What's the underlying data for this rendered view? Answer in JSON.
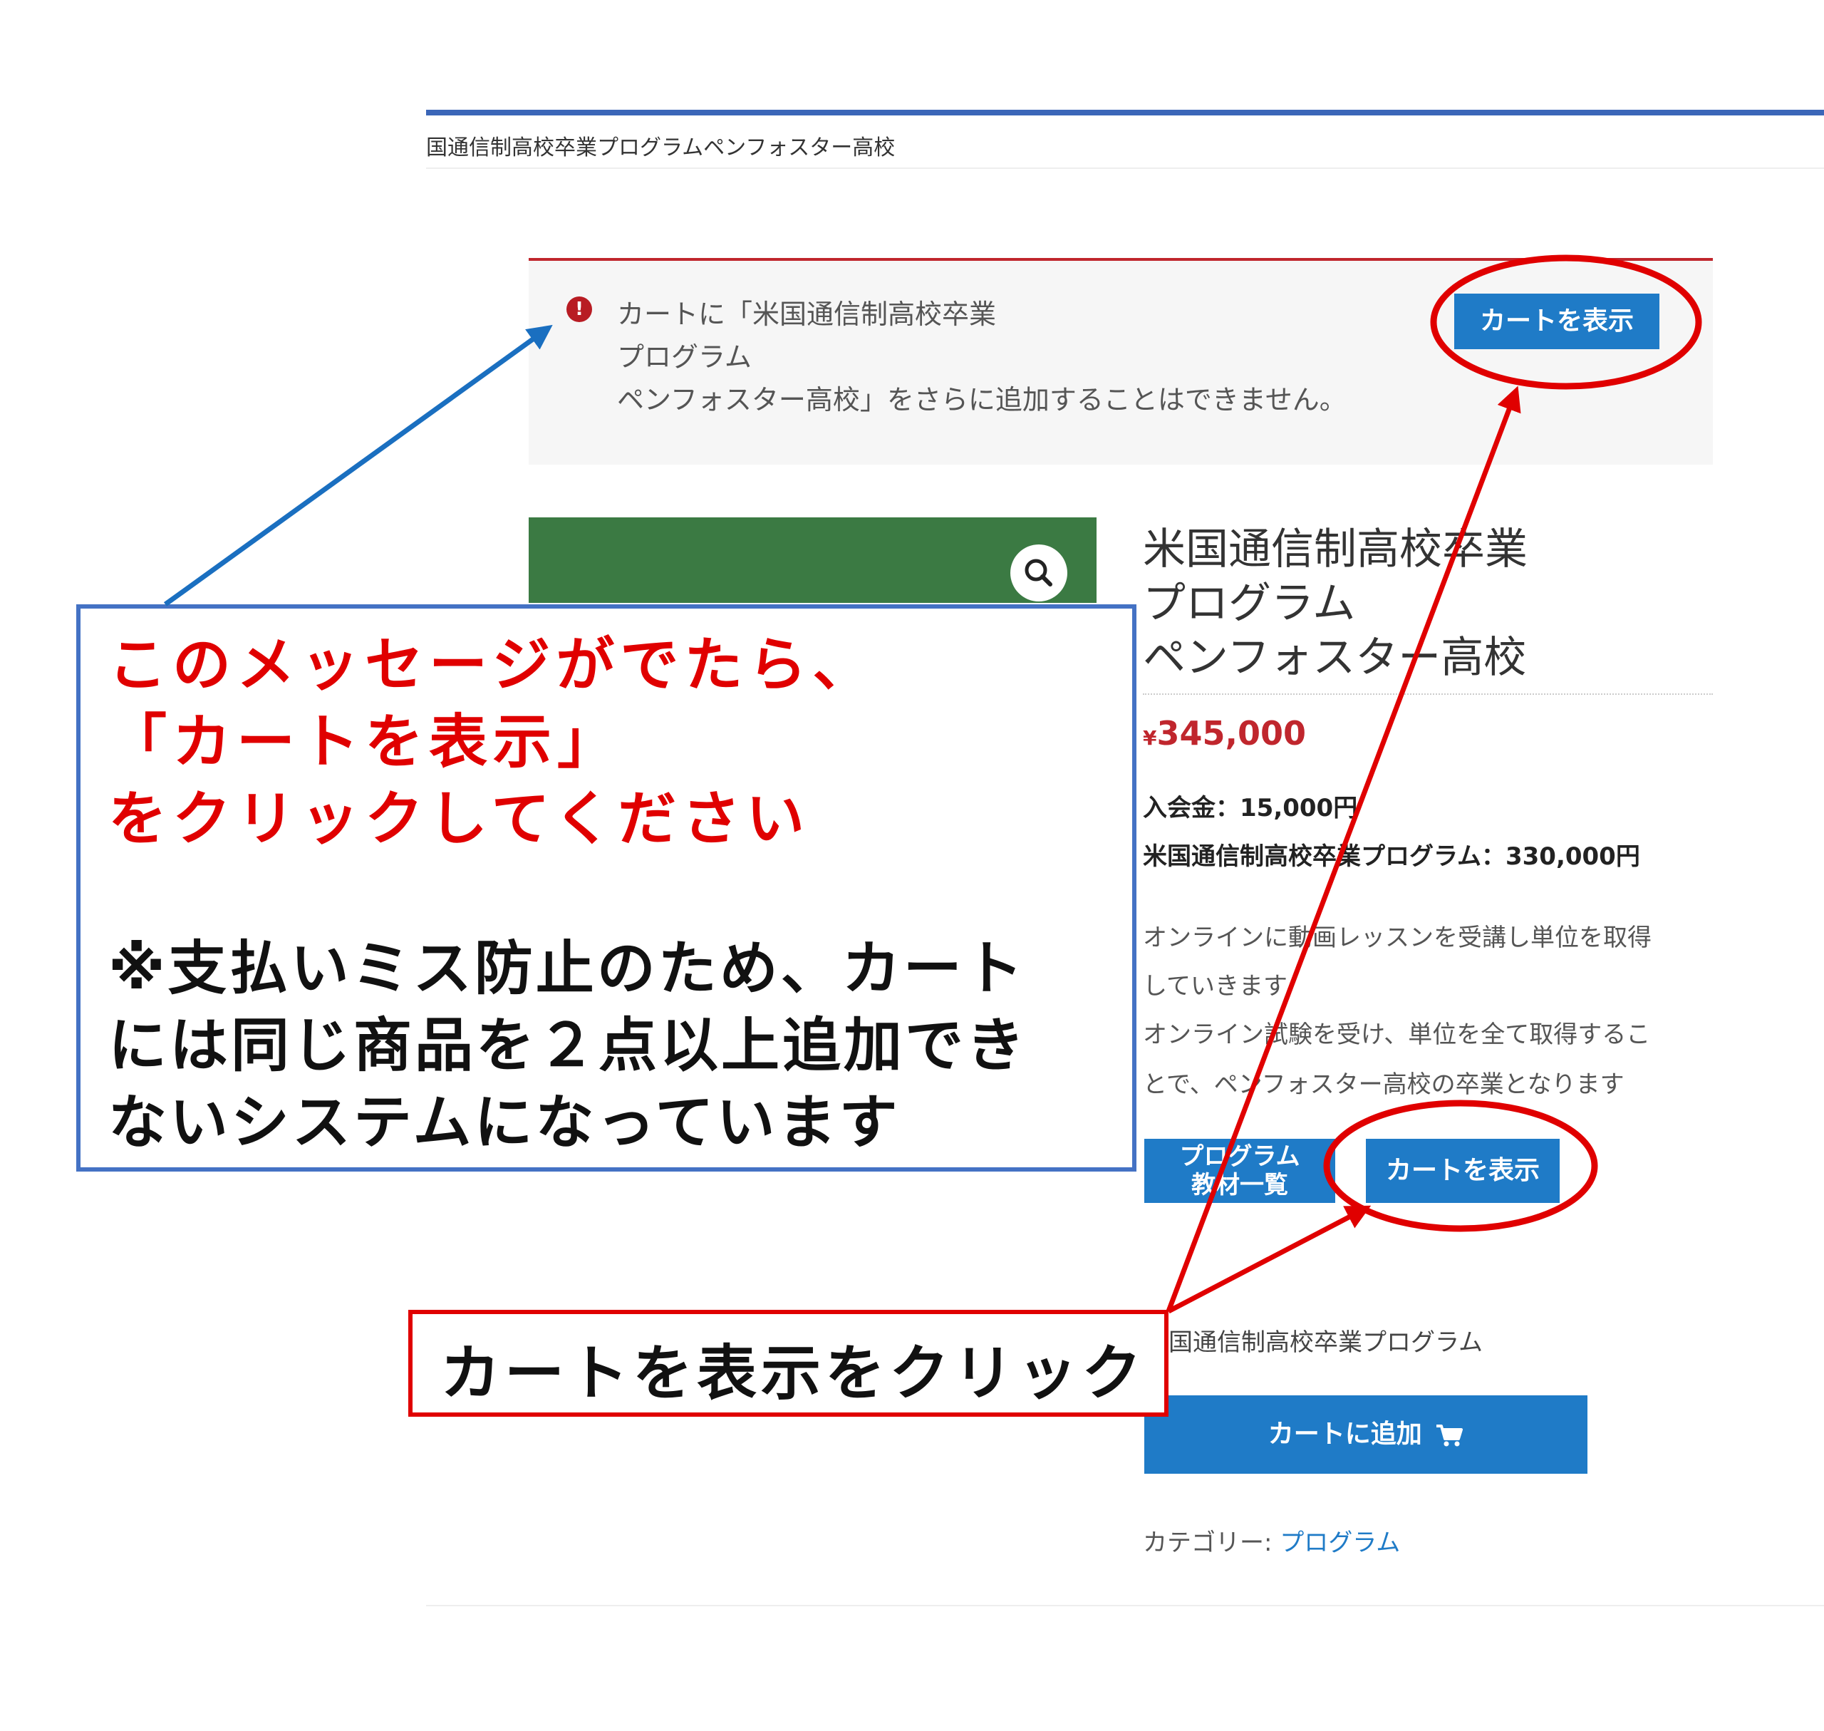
{
  "header": {
    "breadcrumb": "国通信制高校卒業プログラムペンフォスター高校"
  },
  "notice": {
    "icon": "exclamation-icon",
    "icon_glyph": "!",
    "lines": [
      "カートに「米国通信制高校卒業",
      "プログラム",
      "ペンフォスター高校」をさらに追加することはできません。"
    ],
    "view_cart_label": "カートを表示"
  },
  "product": {
    "title_lines": [
      "米国通信制高校卒業",
      "プログラム",
      "ペンフォスター高校"
    ],
    "price_currency": "¥",
    "price_amount": "345,000",
    "fees": [
      "入会金：15,000円",
      "米国通信制高校卒業プログラム：330,000円"
    ],
    "description": [
      "オンラインに動画レッスンを受講し単位を取得",
      "していきます",
      "オンライン試験を受け、単位を全て取得するこ",
      "とで、ペンフォスター高校の卒業となります"
    ],
    "materials_button": [
      "プログラム",
      "教材一覧"
    ],
    "view_cart_label": "カートを表示",
    "variation_label": "国通信制高校卒業プログラム",
    "add_to_cart_label": "カートに追加",
    "cart_icon": "cart-icon",
    "zoom_icon": "magnifier-icon",
    "category_label": "カテゴリー: ",
    "category_link": "プログラム"
  },
  "annotations": {
    "callout_red": [
      "このメッセージがでたら、",
      "「カートを表示」",
      "をクリックしてください"
    ],
    "callout_black": [
      "※支払いミス防止のため、カート",
      "には同じ商品を２点以上追加でき",
      "ないシステムになっています"
    ],
    "click_label": "カートを表示をクリック",
    "colors": {
      "arrow_blue": "#1a6fc0",
      "arrow_red": "#e00000",
      "callout_border": "#4472c4"
    }
  }
}
